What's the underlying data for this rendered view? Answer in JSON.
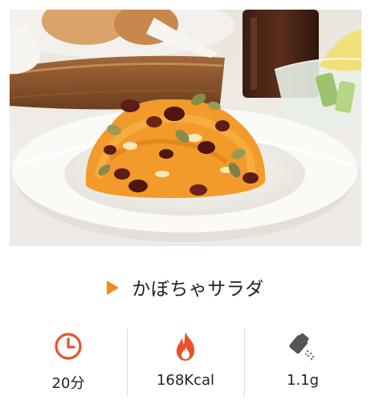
{
  "recipe": {
    "title": "かぼちゃサラダ"
  },
  "stats": {
    "time": {
      "value": "20分",
      "icon": "clock-icon"
    },
    "calories": {
      "value": "168Kcal",
      "icon": "flame-icon"
    },
    "salt": {
      "value": "1.1g",
      "icon": "salt-shaker-icon"
    }
  },
  "colors": {
    "accent": "#ef8a1a",
    "icon_red": "#e8512e"
  }
}
